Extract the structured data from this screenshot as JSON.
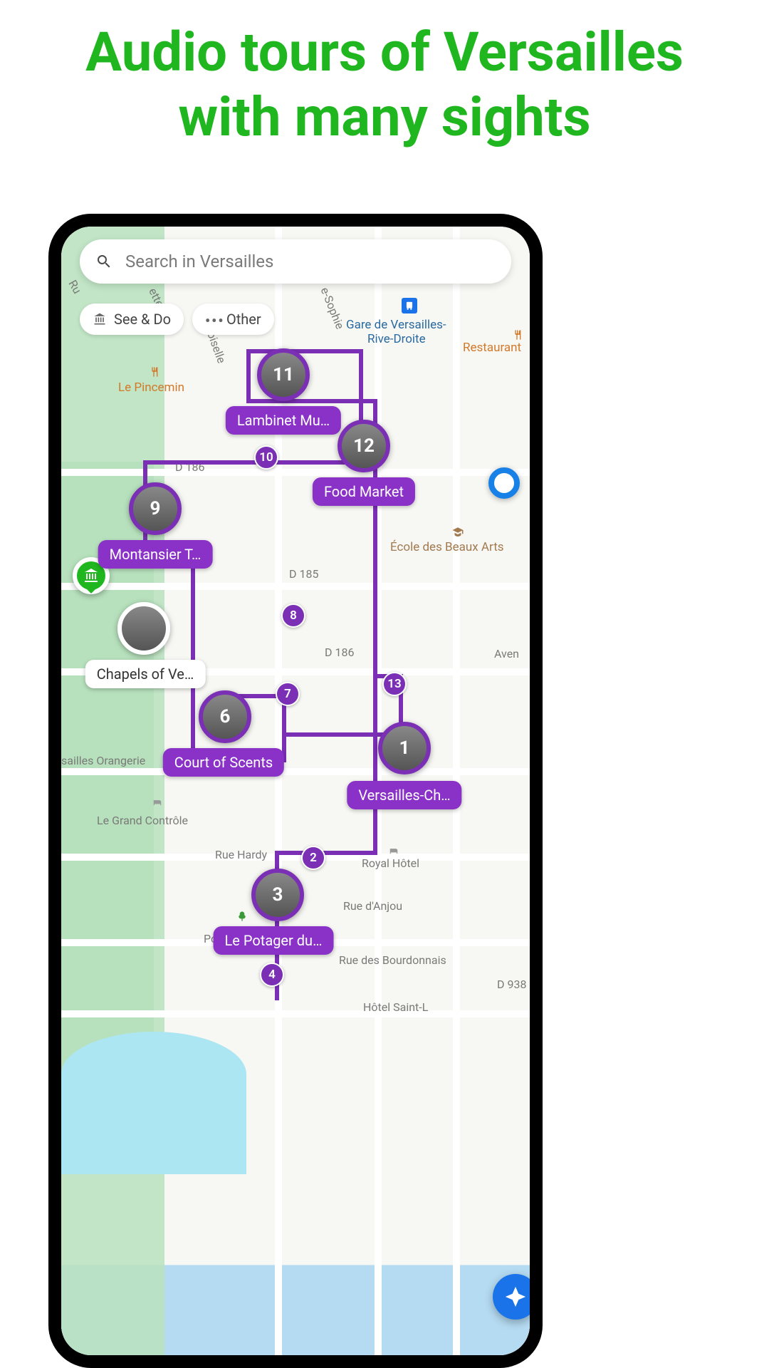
{
  "headline": "Audio tours of Versailles with many sights",
  "search": {
    "placeholder": "Search in Versailles"
  },
  "filters": {
    "see_do": "See & Do",
    "other": "Other"
  },
  "map_labels": {
    "gare_line1": "Gare de Versailles-",
    "gare_line2": "Rive-Droite",
    "restaurant": "Restaurant",
    "pincemin": "Le Pincemin",
    "ecole": "École des Beaux Arts",
    "orangerie": "sailles Orangerie",
    "grand_controle": "Le Grand Contrôle",
    "rue_hardy": "Rue Hardy",
    "royal_hotel": "Royal Hôtel",
    "rue_anjou": "Rue d'Anjou",
    "rue_bourdonnais": "Rue des Bourdonnais",
    "hotel_saintl": "Hôtel Saint-L",
    "avenue": "Aven",
    "pot": "Pot",
    "d185": "D 185",
    "d186": "D 186",
    "d938": "D 938",
    "rue_sophie": "e-Sophie",
    "rue_oiselle": "oiselle",
    "rue_ette": "ette",
    "rue_ru": "Ru"
  },
  "stops": {
    "s11": {
      "num": "11",
      "label": "Lambinet Mu…"
    },
    "s12": {
      "num": "12",
      "label": "Food Market"
    },
    "s9": {
      "num": "9",
      "label": "Montansier T…"
    },
    "s6": {
      "num": "6",
      "label": "Court of Scents"
    },
    "s1": {
      "num": "1",
      "label": "Versailles-Ch…"
    },
    "s3": {
      "num": "3",
      "label": "Le Potager du…"
    },
    "chapels": {
      "label": "Chapels of Ve…"
    },
    "small": {
      "n2": "2",
      "n4": "4",
      "n7": "7",
      "n8": "8",
      "n10": "10",
      "n13": "13"
    }
  }
}
